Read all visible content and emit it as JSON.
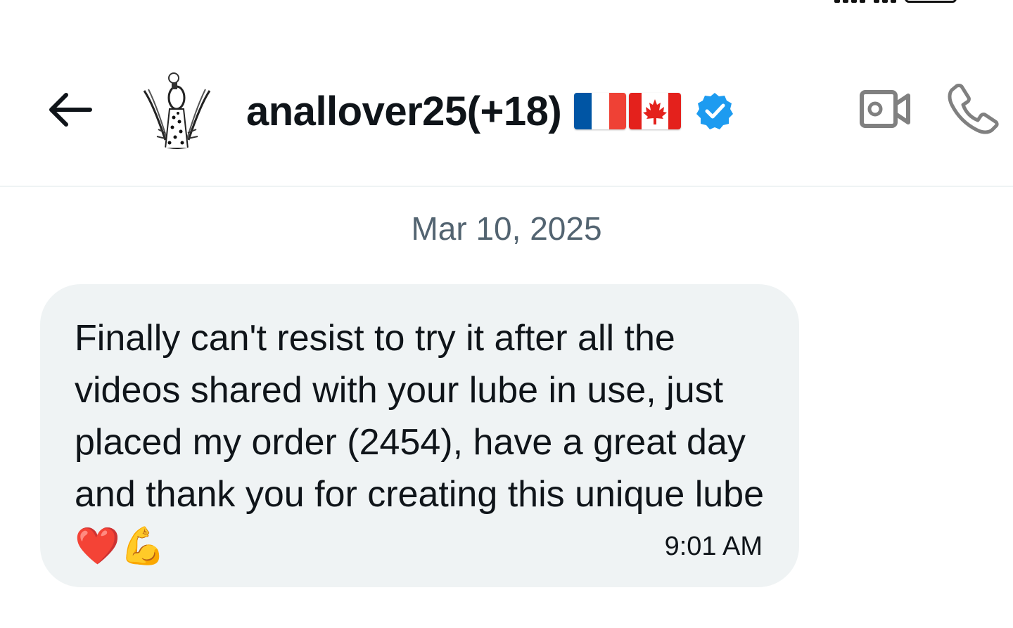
{
  "header": {
    "username": "anallover25(+18)",
    "flags": [
      "france-flag",
      "canada-flag"
    ],
    "verified": true,
    "back_icon": "arrow-left-icon",
    "video_icon": "video-camera-icon",
    "call_icon": "phone-icon"
  },
  "conversation": {
    "date_separator": "Mar 10, 2025",
    "messages": [
      {
        "text": "Finally can't resist to try it after all the videos shared with your lube in use, just placed my order (2454), have a great day and thank you for creating this unique lube",
        "emoji": "❤️💪",
        "time": "9:01 AM"
      }
    ]
  },
  "colors": {
    "bubble_bg": "#eff3f4",
    "date_text": "#536471",
    "verified_blue": "#1d9bf0",
    "icon_gray": "#808080"
  }
}
